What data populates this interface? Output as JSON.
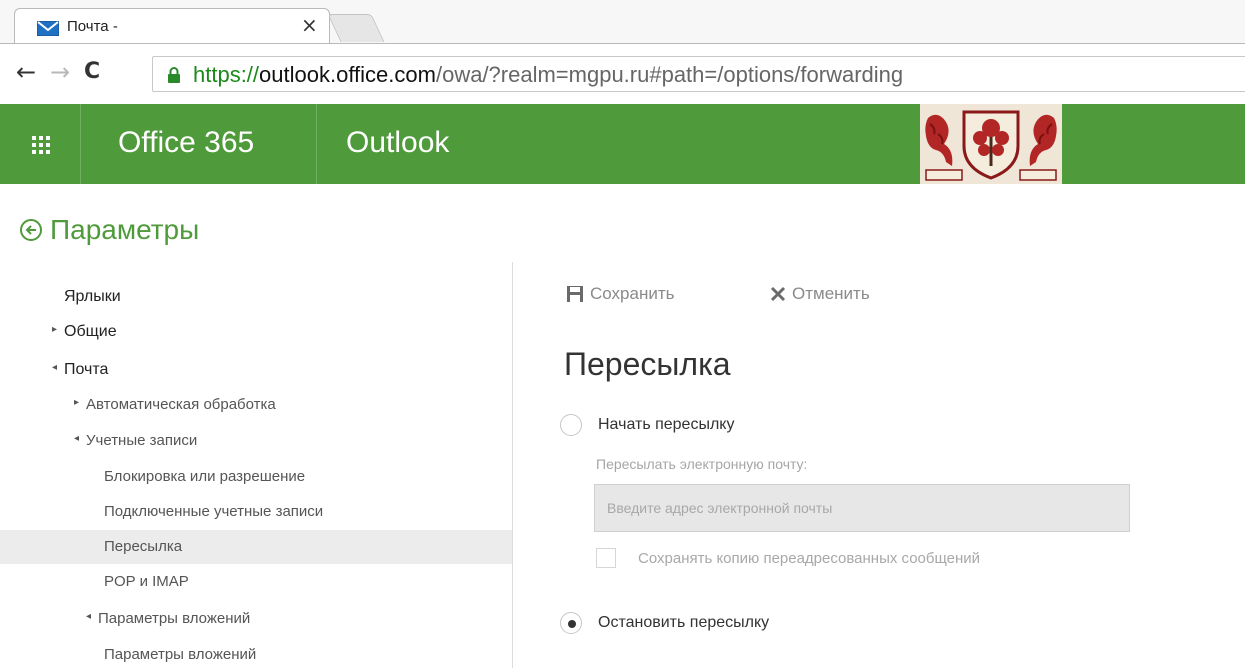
{
  "browser": {
    "tab_title": "Почта -",
    "tab_close": "×",
    "url_scheme": "https://",
    "url_host": "outlook.office.com",
    "url_path": "/owa/?realm=mgpu.ru#path=/options/forwarding"
  },
  "header": {
    "product": "Office 365",
    "app": "Outlook",
    "accent_color": "#4f9a3b"
  },
  "settings": {
    "title": "Параметры"
  },
  "leftnav": {
    "items": [
      {
        "label": "Ярлыки",
        "arrow": ""
      },
      {
        "label": "Общие",
        "arrow": "▸"
      },
      {
        "label": "Почта",
        "arrow": "◂"
      },
      {
        "label": "Автоматическая обработка",
        "arrow": "▸"
      },
      {
        "label": "Учетные записи",
        "arrow": "◂"
      },
      {
        "label": "Блокировка или разрешение",
        "arrow": ""
      },
      {
        "label": "Подключенные учетные записи",
        "arrow": ""
      },
      {
        "label": "Пересылка",
        "arrow": ""
      },
      {
        "label": "POP и IMAP",
        "arrow": ""
      },
      {
        "label": "Параметры вложений",
        "arrow": "◂"
      },
      {
        "label": "Параметры вложений",
        "arrow": ""
      }
    ]
  },
  "actions": {
    "save": "Сохранить",
    "cancel": "Отменить"
  },
  "forwarding": {
    "heading": "Пересылка",
    "start_label": "Начать пересылку",
    "field_label": "Пересылать электронную почту:",
    "email_placeholder": "Введите адрес электронной почты",
    "email_value": "",
    "keep_copy_label": "Сохранять копию переадресованных сообщений",
    "stop_label": "Остановить пересылку",
    "selected": "stop"
  }
}
